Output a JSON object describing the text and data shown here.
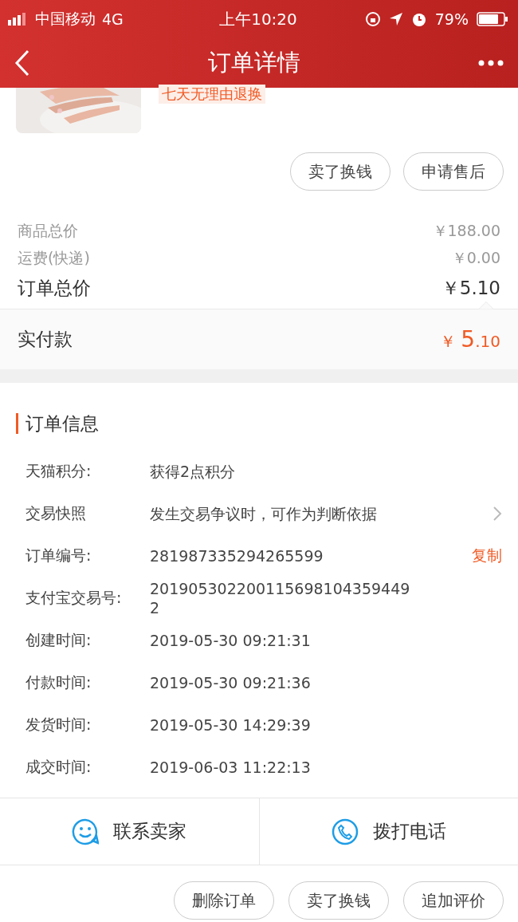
{
  "status_bar": {
    "carrier": "中国移动",
    "network": "4G",
    "time": "上午10:20",
    "battery": "79%"
  },
  "nav": {
    "title": "订单详情"
  },
  "product": {
    "tag": "七天无理由退换"
  },
  "item_actions": [
    "卖了换钱",
    "申请售后"
  ],
  "prices": [
    {
      "kind": "minor",
      "label": "商品总价",
      "value": "￥188.00"
    },
    {
      "kind": "minor",
      "label": "运费(快递)",
      "value": "￥0.00"
    },
    {
      "kind": "major",
      "label": "订单总价",
      "value": "￥5.10"
    }
  ],
  "paid": {
    "label": "实付款",
    "currency": "￥",
    "integer": "5",
    "decimal": ".10"
  },
  "order_info": {
    "title": "订单信息",
    "rows": [
      {
        "label": "天猫积分:",
        "value": "获得2点积分"
      },
      {
        "label": "交易快照",
        "value": "发生交易争议时，可作为判断依据",
        "kind": "link"
      },
      {
        "label": "订单编号:",
        "value": "281987335294265599",
        "action": "复制"
      },
      {
        "label": "支付宝交易号:",
        "value": "2019053022001156981043594492"
      },
      {
        "label": "创建时间:",
        "value": "2019-05-30 09:21:31"
      },
      {
        "label": "付款时间:",
        "value": "2019-05-30 09:21:36"
      },
      {
        "label": "发货时间:",
        "value": "2019-05-30 14:29:39"
      },
      {
        "label": "成交时间:",
        "value": "2019-06-03 11:22:13"
      }
    ]
  },
  "contact": [
    {
      "kind": "chat",
      "label": "联系卖家"
    },
    {
      "kind": "phone",
      "label": "拨打电话"
    }
  ],
  "bottom_actions": [
    "删除订单",
    "卖了换钱",
    "追加评价"
  ]
}
